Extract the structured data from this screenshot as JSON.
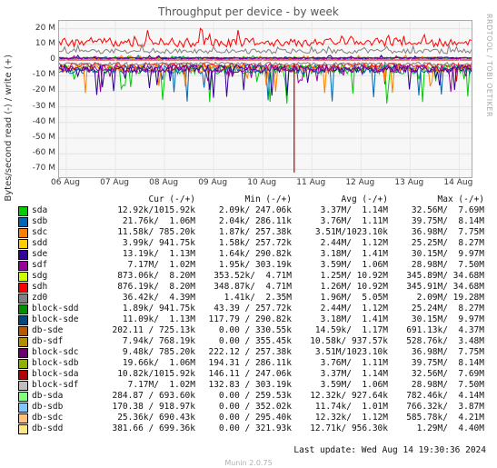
{
  "title": "Throughput per device - by week",
  "side_text": "RRDTOOL / TOBI OETIKER",
  "ylabel": "Bytes/second read (-) / write (+)",
  "footer": "Last update: Wed Aug 14 19:30:36 2024",
  "watermark": "Munin 2.0.75",
  "chart_data": {
    "type": "line",
    "title": "Throughput per device - by week",
    "xlabel": "",
    "ylabel": "Bytes/second read (-) / write (+)",
    "ylim": [
      -75000000,
      25000000
    ],
    "yticks": [
      "20 M",
      "10 M",
      "0",
      "-10 M",
      "-20 M",
      "-30 M",
      "-40 M",
      "-50 M",
      "-60 M",
      "-70 M"
    ],
    "categories": [
      "06 Aug",
      "07 Aug",
      "08 Aug",
      "09 Aug",
      "10 Aug",
      "11 Aug",
      "12 Aug",
      "13 Aug",
      "14 Aug"
    ],
    "series_stats": [
      {
        "name": "sda",
        "color": "#00cc00",
        "cur": "12.92k/1015.92k",
        "min": "2.09k/ 247.06k",
        "avg": "3.37M/  1.14M",
        "max": "32.56M/  7.69M"
      },
      {
        "name": "sdb",
        "color": "#0066b3",
        "cur": "21.76k/  1.06M",
        "min": "2.04k/ 286.11k",
        "avg": "3.76M/  1.11M",
        "max": "39.75M/  8.14M"
      },
      {
        "name": "sdc",
        "color": "#ff8000",
        "cur": "11.58k/ 785.20k",
        "min": "1.87k/ 257.38k",
        "avg": "3.51M/1023.10k",
        "max": "36.98M/  7.75M"
      },
      {
        "name": "sdd",
        "color": "#ffcc00",
        "cur": "3.99k/ 941.75k",
        "min": "1.58k/ 257.72k",
        "avg": "2.44M/  1.12M",
        "max": "25.25M/  8.27M"
      },
      {
        "name": "sde",
        "color": "#330099",
        "cur": "13.19k/  1.13M",
        "min": "1.64k/ 290.82k",
        "avg": "3.18M/  1.41M",
        "max": "30.15M/  9.97M"
      },
      {
        "name": "sdf",
        "color": "#990099",
        "cur": "7.17M/  1.02M",
        "min": "1.95k/ 303.19k",
        "avg": "3.59M/  1.06M",
        "max": "28.98M/  7.50M"
      },
      {
        "name": "sdg",
        "color": "#ccff00",
        "cur": "873.06k/  8.20M",
        "min": "353.52k/  4.71M",
        "avg": "1.25M/ 10.92M",
        "max": "345.89M/ 34.68M"
      },
      {
        "name": "sdh",
        "color": "#ff0000",
        "cur": "876.19k/  8.20M",
        "min": "348.87k/  4.71M",
        "avg": "1.26M/ 10.92M",
        "max": "345.91M/ 34.68M"
      },
      {
        "name": "zd0",
        "color": "#808080",
        "cur": "36.42k/  4.39M",
        "min": "1.41k/  2.35M",
        "avg": "1.96M/  5.05M",
        "max": "2.09M/ 19.28M"
      },
      {
        "name": "block-sdd",
        "color": "#008f00",
        "cur": "1.89k/ 941.75k",
        "min": "43.39 / 257.72k",
        "avg": "2.44M/  1.12M",
        "max": "25.24M/  8.27M"
      },
      {
        "name": "block-sde",
        "color": "#00487d",
        "cur": "11.09k/  1.13M",
        "min": "117.79 / 290.82k",
        "avg": "3.18M/  1.41M",
        "max": "30.15M/  9.97M"
      },
      {
        "name": "db-sde",
        "color": "#b35a00",
        "cur": "202.11 / 725.13k",
        "min": "0.00 / 330.55k",
        "avg": "14.59k/  1.17M",
        "max": "691.13k/  4.37M"
      },
      {
        "name": "db-sdf",
        "color": "#b38f00",
        "cur": "7.94k/ 768.19k",
        "min": "0.00 / 355.45k",
        "avg": "10.58k/ 937.57k",
        "max": "528.76k/  3.48M"
      },
      {
        "name": "block-sdc",
        "color": "#6b006b",
        "cur": "9.48k/ 785.20k",
        "min": "222.12 / 257.38k",
        "avg": "3.51M/1023.10k",
        "max": "36.98M/  7.75M"
      },
      {
        "name": "block-sdb",
        "color": "#8fb300",
        "cur": "19.66k/  1.06M",
        "min": "194.31 / 286.11k",
        "avg": "3.76M/  1.11M",
        "max": "39.75M/  8.14M"
      },
      {
        "name": "block-sda",
        "color": "#b30000",
        "cur": "10.82k/1015.92k",
        "min": "146.11 / 247.06k",
        "avg": "3.37M/  1.14M",
        "max": "32.56M/  7.69M"
      },
      {
        "name": "block-sdf",
        "color": "#bebebe",
        "cur": "7.17M/  1.02M",
        "min": "132.83 / 303.19k",
        "avg": "3.59M/  1.06M",
        "max": "28.98M/  7.50M"
      },
      {
        "name": "db-sda",
        "color": "#80ff80",
        "cur": "284.87 / 693.60k",
        "min": "0.00 / 259.53k",
        "avg": "12.32k/ 927.64k",
        "max": "782.46k/  4.14M"
      },
      {
        "name": "db-sdb",
        "color": "#80c9ff",
        "cur": "170.38 / 918.97k",
        "min": "0.00 / 352.02k",
        "avg": "11.74k/  1.01M",
        "max": "766.32k/  3.87M"
      },
      {
        "name": "db-sdc",
        "color": "#ffc080",
        "cur": "25.36k/ 690.43k",
        "min": "0.00 / 295.40k",
        "avg": "12.32k/  1.12M",
        "max": "585.78k/  4.21M"
      },
      {
        "name": "db-sdd",
        "color": "#ffe680",
        "cur": "381.66 / 699.36k",
        "min": "0.00 / 321.93k",
        "avg": "12.71k/ 956.30k",
        "max": "1.29M/  4.40M"
      }
    ]
  },
  "legend_headers": {
    "cur": "Cur (-/+)",
    "min": "Min (-/+)",
    "avg": "Avg (-/+)",
    "max": "Max (-/+)"
  }
}
